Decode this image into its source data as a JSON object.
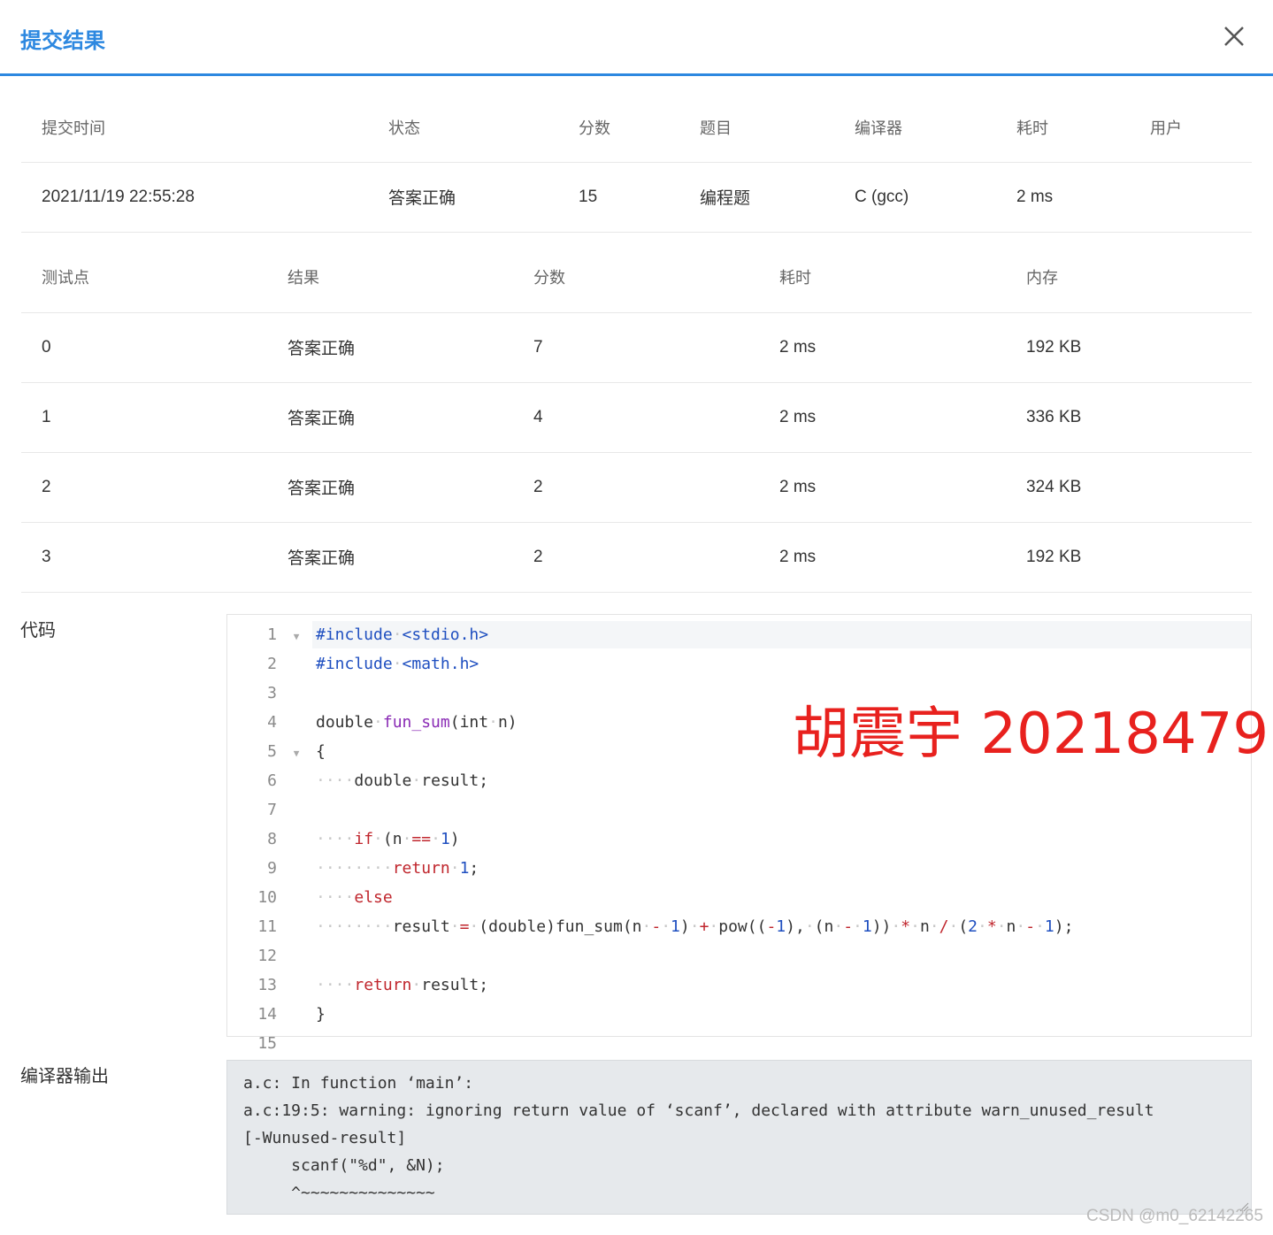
{
  "dialog": {
    "title": "提交结果"
  },
  "summary": {
    "headers": [
      "提交时间",
      "状态",
      "分数",
      "题目",
      "编译器",
      "耗时",
      "用户"
    ],
    "row": [
      "2021/11/19 22:55:28",
      "答案正确",
      "15",
      "编程题",
      "C (gcc)",
      "2 ms",
      ""
    ]
  },
  "cases": {
    "headers": [
      "测试点",
      "结果",
      "分数",
      "耗时",
      "内存"
    ],
    "rows": [
      [
        "0",
        "答案正确",
        "7",
        "2 ms",
        "192 KB"
      ],
      [
        "1",
        "答案正确",
        "4",
        "2 ms",
        "336 KB"
      ],
      [
        "2",
        "答案正确",
        "2",
        "2 ms",
        "324 KB"
      ],
      [
        "3",
        "答案正确",
        "2",
        "2 ms",
        "192 KB"
      ]
    ]
  },
  "code_section": {
    "label": "代码",
    "line_numbers": [
      "1",
      "2",
      "3",
      "4",
      "5",
      "6",
      "7",
      "8",
      "9",
      "10",
      "11",
      "12",
      "13",
      "14",
      "15"
    ]
  },
  "annotation": "胡震宇 20218479",
  "compiler_output": {
    "label": "编译器输出",
    "text": "a.c: In function ‘main’:\na.c:19:5: warning: ignoring return value of ‘scanf’, declared with attribute warn_unused_result\n[-Wunused-result]\n     scanf(\"%d\", &N);\n     ^~~~~~~~~~~~~~~"
  },
  "watermark": "CSDN @m0_62142265",
  "colors": {
    "accent": "#2d88e0",
    "accepted": "#e53935",
    "annotation": "#e8211e"
  }
}
